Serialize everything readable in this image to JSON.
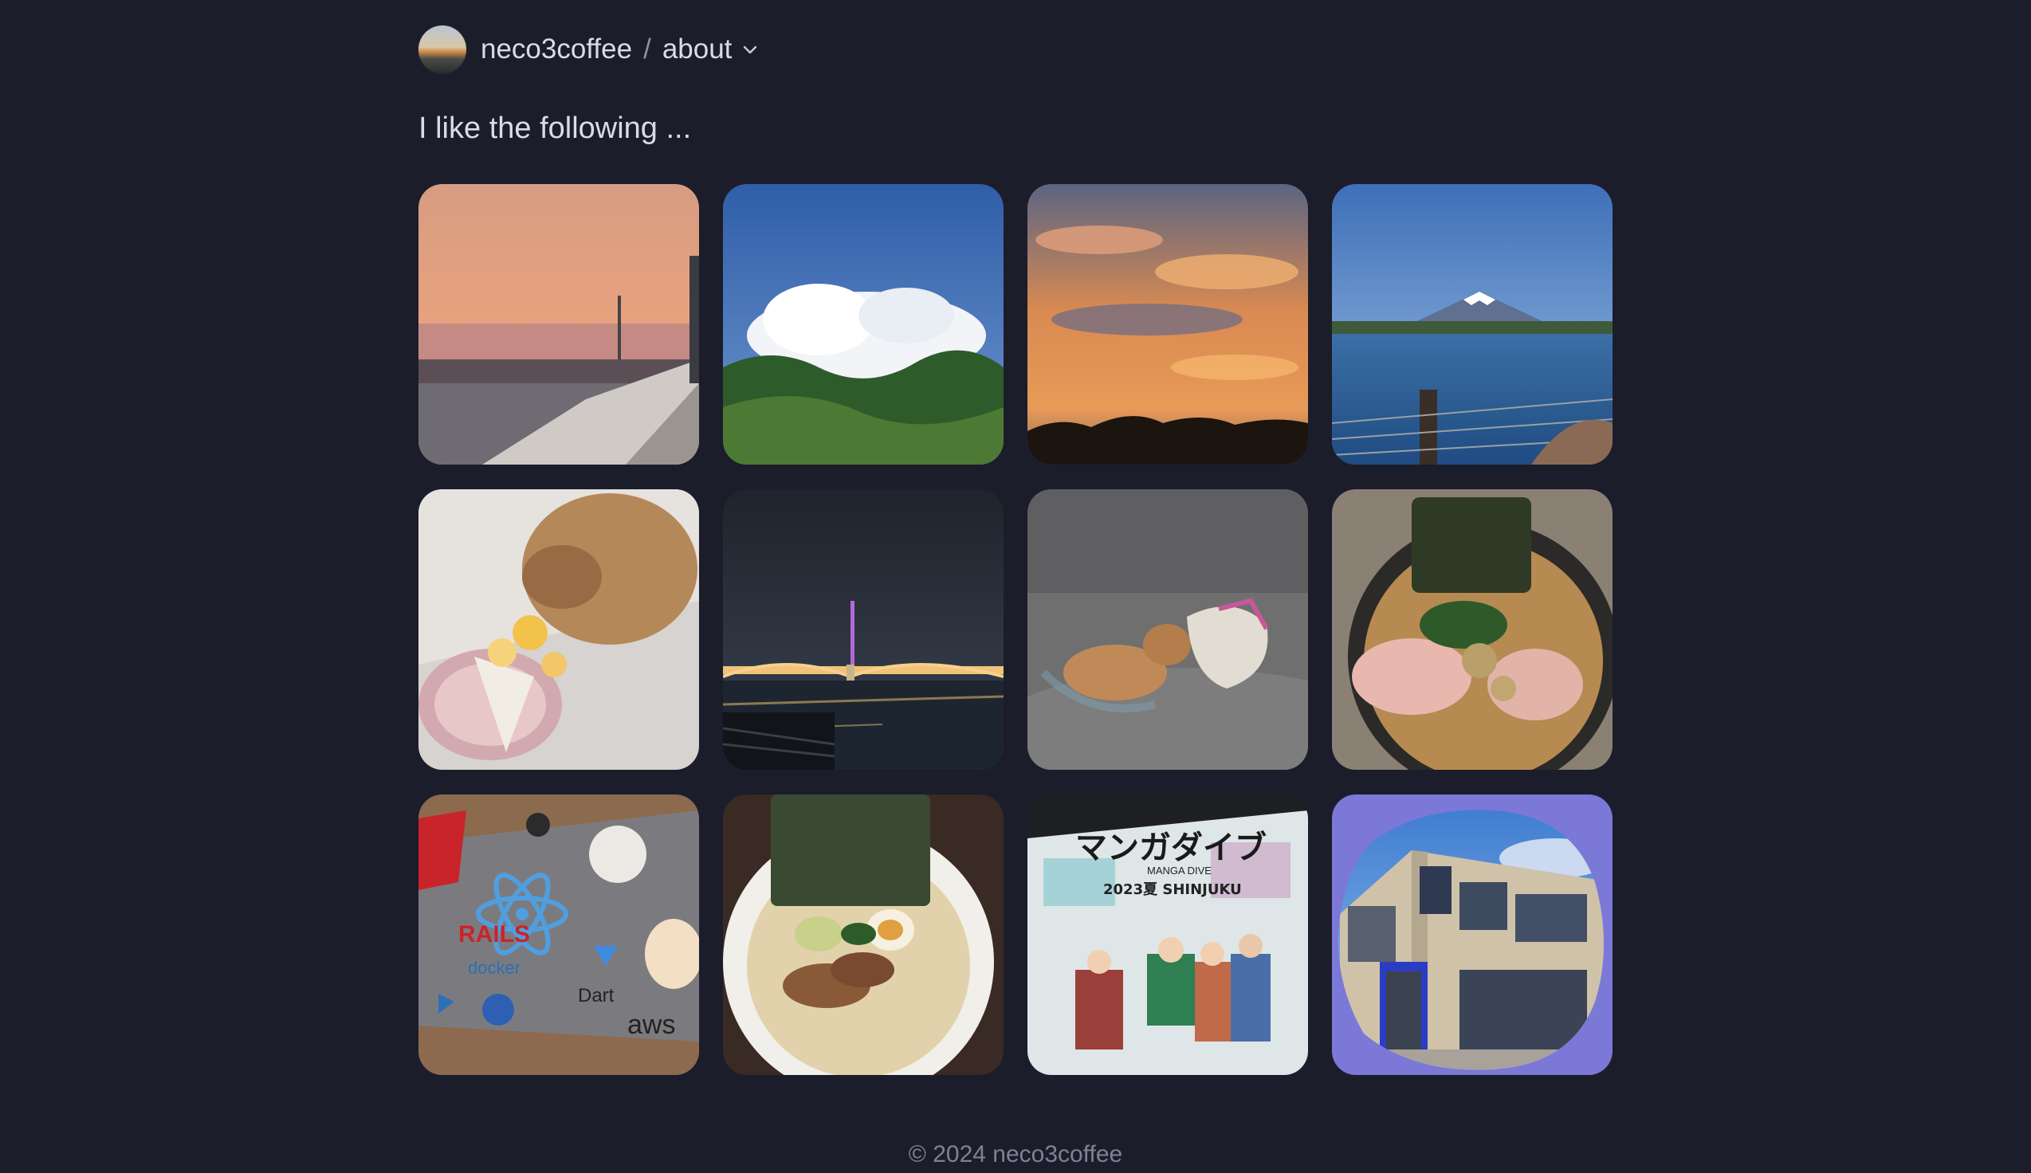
{
  "header": {
    "user": "neco3coffee",
    "separator": "/",
    "page": "about"
  },
  "intro": "I like the following ...",
  "photos": [
    {
      "subject": "sunset over bay from balcony"
    },
    {
      "subject": "summer cloud over trees"
    },
    {
      "subject": "orange sunset clouds"
    },
    {
      "subject": "Mount Fuji over lake"
    },
    {
      "subject": "poodle with birthday cake"
    },
    {
      "subject": "Sumida river bridge at night with Skytree"
    },
    {
      "subject": "poodle sleeping on sofa"
    },
    {
      "subject": "ramen with nori and chashu"
    },
    {
      "subject": "laptop with tech stickers"
    },
    {
      "subject": "tonkotsu ramen bowl"
    },
    {
      "subject": "manga dive shinjuku poster"
    },
    {
      "subject": "office building under blue sky"
    }
  ],
  "stickers": {
    "docker": "docker",
    "dart": "Dart",
    "aws": "aws",
    "rails": "RAILS"
  },
  "poster": {
    "title": "マンガダイブ",
    "subtitle": "MANGA DIVE",
    "venue": "2023夏 SHINJUKU"
  },
  "footer": "© 2024 neco3coffee",
  "colors": {
    "background": "#1b1d2b",
    "text": "#d9dbe6",
    "muted": "#7f8296",
    "building_tile": "#7b78d8"
  }
}
